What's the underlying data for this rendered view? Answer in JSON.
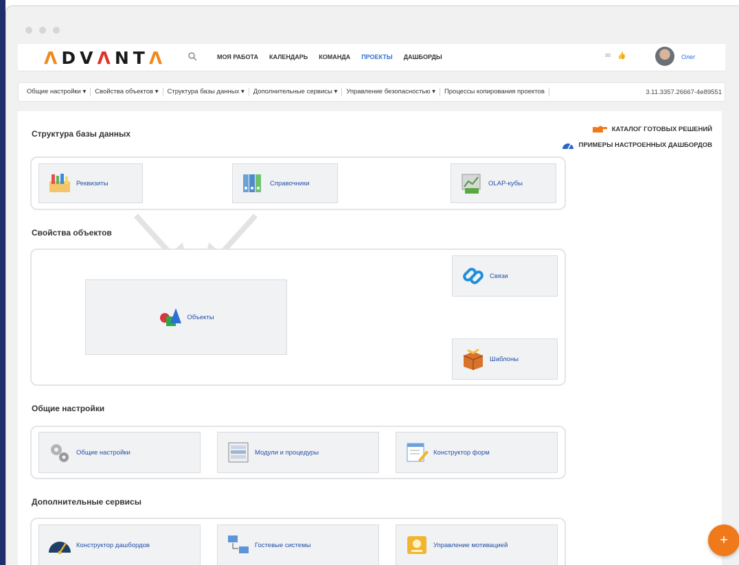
{
  "header": {
    "logo": "ADVANTA",
    "menu": [
      "МОЯ РАБОТА",
      "КАЛЕНДАРЬ",
      "КОМАНДА",
      "ПРОЕКТЫ",
      "ДАШБОРДЫ"
    ],
    "active_menu": "ПРОЕКТЫ",
    "user_name": "Олег"
  },
  "subnav": {
    "items": [
      "Общие настройки ▾",
      "Свойства объектов ▾",
      "Структура базы данных ▾",
      "Дополнительные сервисы ▾",
      "Управление безопасностью ▾",
      "Процессы копирования проектов"
    ],
    "version": "3.11.3357.26667-4e89551"
  },
  "right_links": {
    "catalog": "КАТАЛОГ ГОТОВЫХ РЕШЕНИЙ",
    "examples": "ПРИМЕРЫ НАСТРОЕННЫХ ДАШБОРДОВ"
  },
  "sections": {
    "db": {
      "title": "Структура базы данных",
      "tiles": [
        "Реквизиты",
        "Справочники",
        "OLAP-кубы"
      ]
    },
    "props": {
      "title": "Свойства объектов",
      "tiles": [
        "Объекты",
        "Связи",
        "Шаблоны"
      ]
    },
    "general": {
      "title": "Общие настройки",
      "tiles": [
        "Общие настройки",
        "Модули и процедуры",
        "Конструктор форм"
      ]
    },
    "extra": {
      "title": "Дополнительные сервисы",
      "tiles": [
        "Конструктор дашбордов",
        "Гостевые системы",
        "Управление мотивацией"
      ]
    }
  },
  "fab_label": "+",
  "colors": {
    "accent": "#2f6fd6",
    "fab": "#f07a1a",
    "tile_bg": "#f1f2f4"
  }
}
